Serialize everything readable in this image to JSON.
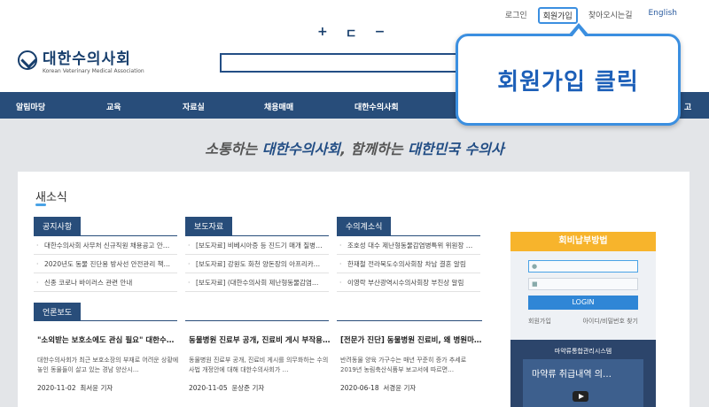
{
  "util_nav": {
    "login": "로그인",
    "join": "회원가입",
    "directions": "찾아오시는길",
    "english": "English"
  },
  "logo": {
    "title": "대한수의사회",
    "subtitle": "Korean Veterinary Medical Association"
  },
  "font_controls": {
    "increase": "+",
    "reset": "ㄷ",
    "decrease": "−"
  },
  "nav": [
    "알림마당",
    "교육",
    "자료실",
    "채용매매",
    "대한수의사회",
    "고"
  ],
  "slogan": {
    "part1": "소통하는 ",
    "highlight1": "대한수의사회",
    "part2": ", 함께하는 ",
    "highlight2": "대한민국 수의사"
  },
  "news": {
    "title": "새소식",
    "sections": [
      {
        "label": "공지사항",
        "items": [
          "대한수의사회 사무처 신규직원 채용공고 안…",
          "2020년도 동물 진단용 방사선 안전관리 책…",
          "신종 코로나 바이러스 관련 안내"
        ]
      },
      {
        "label": "보도자료",
        "items": [
          "[보도자료] 비베시아증 등 진드기 매개 질병…",
          "[보도자료] 강원도 화천 양돈장의 아프리카…",
          "[보도자료] (대한수의사회 제난형동물감염…"
        ]
      },
      {
        "label": "수의계소식",
        "items": [
          "조호성 대수 제난형동물감염병특위 위원장 …",
          "한재철 전라북도수의사회장 차남 결혼 알림",
          "이영락 부산광역시수의사회장 부친상 알림"
        ]
      }
    ],
    "press_label": "언론보도",
    "press": [
      {
        "title": "\"소외받는 보호소에도 관심 필요\" 대한수…",
        "desc": "대한수의사회가 최근 보호소장의 부재로 어려운 상황에 놓인 동물들이 살고 있는 경남 양산시…",
        "date": "2020-11-02",
        "author": "최서윤 기자"
      },
      {
        "title": "동물병원 진료부 공개, 진료비 게시 부작용…",
        "desc": "동물병원 진료부 공개, 진료비 게시를 의무화하는 수의사법 개정안에 대해 대한수의사회가 …",
        "date": "2020-11-05",
        "author": "윤상준 기자"
      },
      {
        "title": "[전문가 진단] 동물병원 진료비, 왜 병원마…",
        "desc": "반려동물 양육 가구수는 매년 꾸준히 증가 추세로 2019년 농림축산식품부 보고서에 따르면…",
        "date": "2020-06-18",
        "author": "서경윤 기자"
      }
    ]
  },
  "login_panel": {
    "header": "회비납부방법",
    "button": "LOGIN",
    "join": "회원가입",
    "find": "아이디/비밀번호 찾기"
  },
  "drug_panel": {
    "header": "마약류통합관리시스템",
    "video_text": "마약류 취급내역 의…"
  },
  "callout": {
    "text": "회원가입 클릭"
  },
  "colors": {
    "nav": "#284d7a",
    "accent": "#3b8fe0",
    "login_head": "#f7b42c"
  }
}
